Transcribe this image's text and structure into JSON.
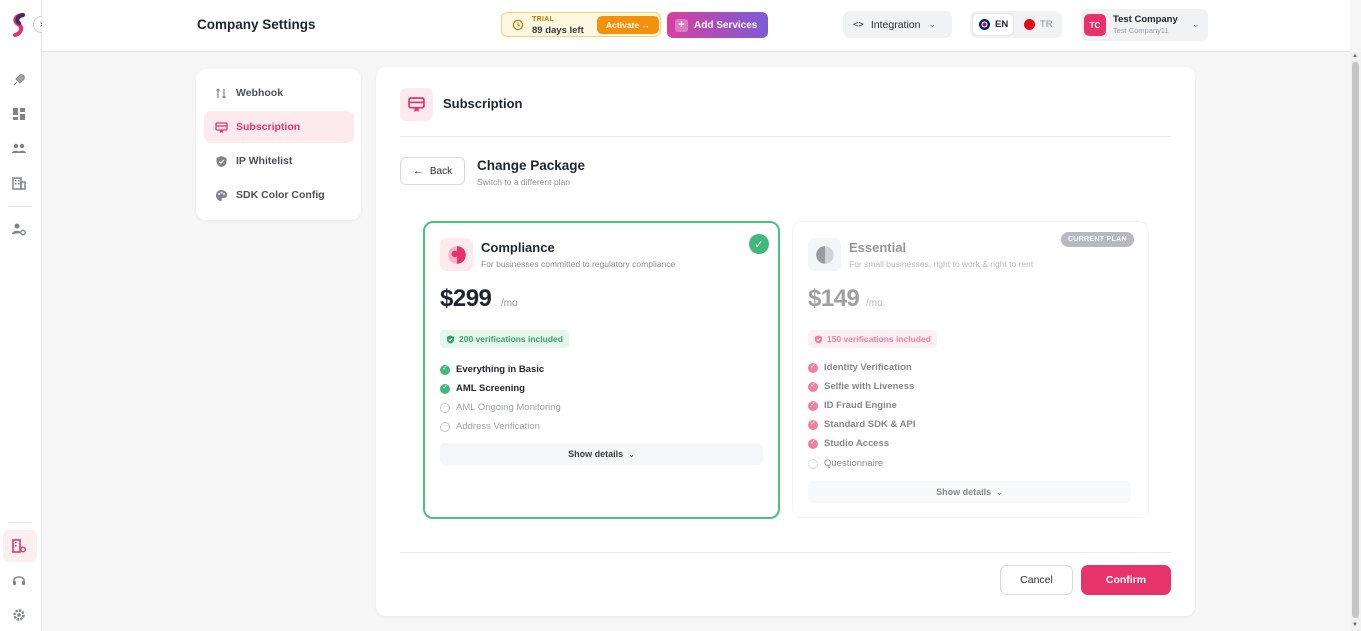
{
  "header": {
    "title": "Company Settings",
    "trial": {
      "label": "TRIAL",
      "days_left": "89 days left",
      "activate_label": "Activate →"
    },
    "add_services_label": "Add Services",
    "integration_label": "Integration",
    "languages": {
      "active": "EN",
      "other": "TR"
    },
    "user": {
      "initials": "TC",
      "name": "Test Company",
      "sub": "Test Company11"
    }
  },
  "settings_menu": {
    "items": [
      {
        "label": "Webhook",
        "icon": "webhook-icon"
      },
      {
        "label": "Subscription",
        "icon": "subscription-icon"
      },
      {
        "label": "IP Whitelist",
        "icon": "shield-icon"
      },
      {
        "label": "SDK Color Config",
        "icon": "palette-icon"
      }
    ],
    "active_index": 1
  },
  "main": {
    "section_title": "Subscription",
    "back_label": "Back",
    "change_title": "Change Package",
    "change_subtitle": "Switch to a different plan",
    "plans": [
      {
        "name": "Compliance",
        "description": "For businesses committed to regulatory compliance",
        "price": "$299",
        "period": "/mo",
        "verifications": "200 verifications included",
        "features": [
          {
            "label": "Everything in Basic",
            "included": true
          },
          {
            "label": "AML Screening",
            "included": true
          },
          {
            "label": "AML Ongoing Monitoring",
            "included": false
          },
          {
            "label": "Address Verification",
            "included": false
          }
        ],
        "show_details_label": "Show details",
        "selected": true
      },
      {
        "name": "Essential",
        "description": "For small businesses, right to work & right to rent",
        "price": "$149",
        "period": "/mo",
        "verifications": "150 verifications included",
        "badge": "CURRENT PLAN",
        "features": [
          {
            "label": "Identity Verification",
            "included": true
          },
          {
            "label": "Selfie with Liveness",
            "included": true
          },
          {
            "label": "ID Fraud Engine",
            "included": true
          },
          {
            "label": "Standard SDK & API",
            "included": true
          },
          {
            "label": "Studio Access",
            "included": true
          },
          {
            "label": "Questionnaire",
            "included": false
          }
        ],
        "show_details_label": "Show details",
        "selected": false
      }
    ],
    "cancel_label": "Cancel",
    "confirm_label": "Confirm"
  },
  "colors": {
    "accent": "#e8336a",
    "success": "#3fb97a",
    "trial": "#f4900c"
  }
}
